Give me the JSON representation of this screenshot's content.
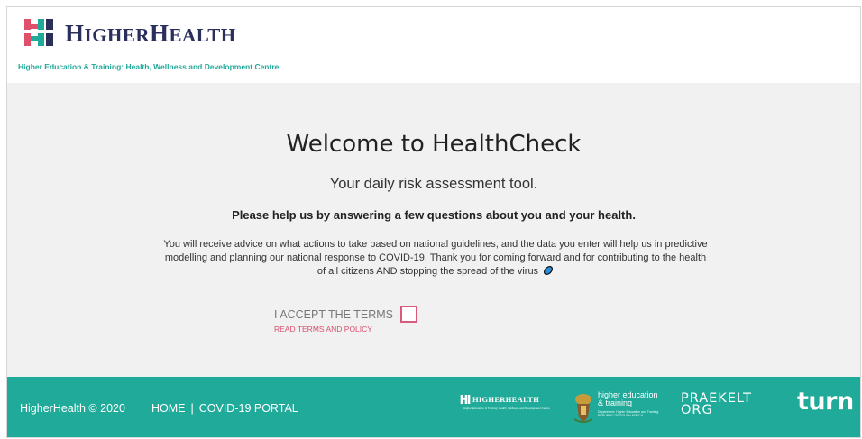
{
  "header": {
    "brand_name": "HIGHERHEALTH",
    "brand_name_first_cap": "H",
    "brand_name_first_rest": "IGHER",
    "brand_name_second_cap": "H",
    "brand_name_second_rest": "EALTH",
    "tagline": "Higher Education & Training: Health, Wellness and Development Centre",
    "logo_colors": {
      "pink": "#e0506b",
      "green": "#20aa99",
      "navy": "#2b2f5c"
    }
  },
  "main": {
    "title": "Welcome to HealthCheck",
    "subtitle": "Your daily risk assessment tool.",
    "prompt": "Please help us by answering a few questions about you and your health.",
    "body": "You will receive advice on what actions to take based on national guidelines, and the data you enter will help us in predictive modelling and planning our national response to COVID-19. Thank you for coming forward and for contributing to the health of all citizens AND stopping the spread of the virus",
    "virus_icon": "virus-icon",
    "accept_label": "I ACCEPT THE TERMS",
    "accept_checked": false,
    "terms_link": "READ TERMS AND POLICY"
  },
  "footer": {
    "copyright": "HigherHealth © 2020",
    "nav": {
      "home": "HOME",
      "separator": "|",
      "portal": "COVID-19 PORTAL"
    },
    "partners": {
      "higherhealth": "HIGHERHEALTH",
      "higherhealth_tagline": "Higher Education & Training: Health, Wellness and Development Centre",
      "dhet_line1": "higher education",
      "dhet_line2": "& training",
      "dhet_line3": "Department: Higher Education and Training",
      "dhet_line4": "REPUBLIC OF SOUTH AFRICA",
      "praekelt_line1": "PRAEKELT",
      "praekelt_line2": "ORG",
      "turn": "turn"
    }
  },
  "colors": {
    "accent": "#20aa99",
    "link": "#d9506e",
    "checkbox_border": "#d95a7a",
    "main_bg": "#f1f1f1"
  }
}
